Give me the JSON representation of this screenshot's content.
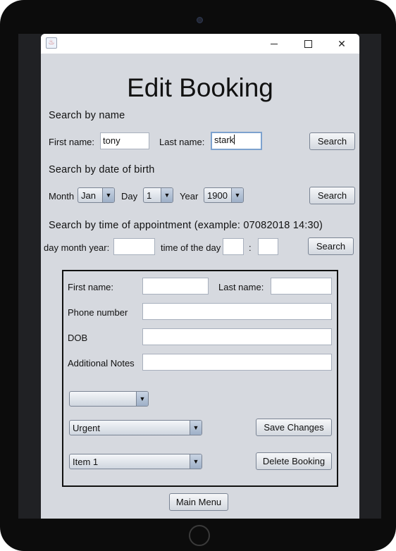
{
  "window": {
    "title": "",
    "minimize_glyph": "",
    "close_glyph": "✕"
  },
  "page_title": "Edit Booking",
  "search_by_name": {
    "heading": "Search by name",
    "first_name_label": "First name:",
    "first_name_value": "tony",
    "last_name_label": "Last name:",
    "last_name_value": "stark",
    "search_label": "Search"
  },
  "search_by_dob": {
    "heading": "Search by date of birth",
    "month_label": "Month",
    "month_value": "Jan",
    "day_label": "Day",
    "day_value": "1",
    "year_label": "Year",
    "year_value": "1900",
    "search_label": "Search"
  },
  "search_by_time": {
    "heading": "Search by time of appointment (example: 07082018 14:30)",
    "date_label": "day month year:",
    "date_value": "",
    "time_label": "time of the day",
    "hour_value": "",
    "colon": ":",
    "minute_value": "",
    "search_label": "Search"
  },
  "details": {
    "first_name_label": "First name:",
    "first_name_value": "",
    "last_name_label": "Last name:",
    "last_name_value": "",
    "phone_label": "Phone number",
    "phone_value": "",
    "dob_label": "DOB",
    "dob_value": "",
    "notes_label": "Additional Notes",
    "notes_value": "",
    "empty_combo_value": "",
    "priority_value": "Urgent",
    "save_label": "Save Changes",
    "item_value": "Item 1",
    "delete_label": "Delete Booking"
  },
  "main_menu_label": "Main Menu",
  "combo_arrow_glyph": "▼"
}
